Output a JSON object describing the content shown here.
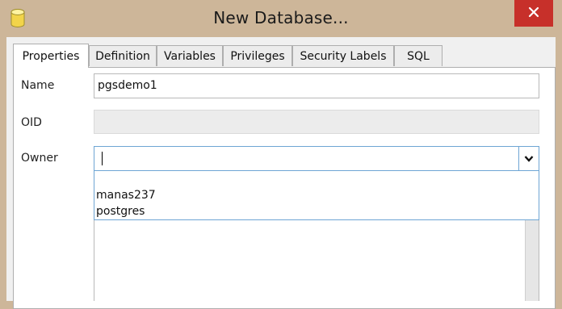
{
  "window": {
    "title": "New Database...",
    "app_icon": "database-icon",
    "close_icon": "close-icon"
  },
  "tabs": [
    {
      "label": "Properties",
      "active": true
    },
    {
      "label": "Definition",
      "active": false
    },
    {
      "label": "Variables",
      "active": false
    },
    {
      "label": "Privileges",
      "active": false
    },
    {
      "label": "Security Labels",
      "active": false
    },
    {
      "label": "SQL",
      "active": false
    }
  ],
  "form": {
    "name_label": "Name",
    "name_value": "pgsdemo1",
    "oid_label": "OID",
    "oid_value": "",
    "owner_label": "Owner",
    "owner_value": "",
    "owner_options": [
      "",
      "manas237",
      "postgres"
    ],
    "dropdown_icon": "chevron-down-icon"
  },
  "colors": {
    "window_frame": "#cdb699",
    "close_button": "#c7302a",
    "focus_border": "#6ea5d4"
  }
}
